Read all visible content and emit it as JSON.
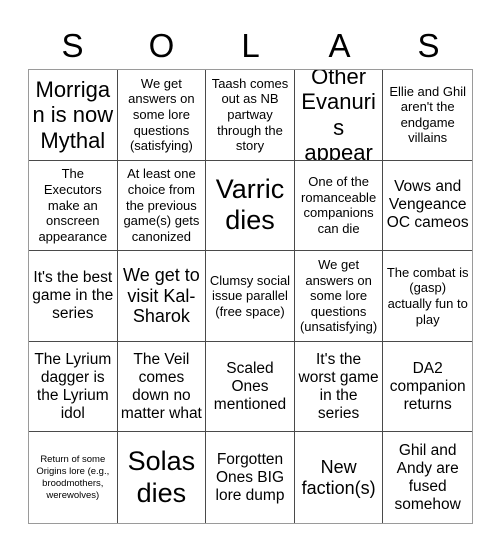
{
  "card": {
    "header_letters": [
      "S",
      "O",
      "L",
      "A",
      "S"
    ],
    "title": "SOLAS",
    "grid_size": "5x5",
    "text_color": "#000000",
    "background_color": "#ffffff",
    "grid_line_color": "#4a4a4a",
    "border_color": "#9a9a9a",
    "cells": [
      {
        "text": "Morrigan is now Mythal",
        "size": "xl",
        "marked": false
      },
      {
        "text": "We get answers on some lore questions (satisfying)",
        "size": "sm",
        "marked": false
      },
      {
        "text": "Taash comes out as NB partway through the story",
        "size": "sm",
        "marked": false
      },
      {
        "text": "Other Evanuris appear",
        "size": "xl",
        "marked": false
      },
      {
        "text": "Ellie and Ghil aren't the endgame villains",
        "size": "sm",
        "marked": false
      },
      {
        "text": "The Executors make an onscreen appearance",
        "size": "sm",
        "marked": false
      },
      {
        "text": "At least one choice from the previous game(s) gets canonized",
        "size": "sm",
        "marked": false
      },
      {
        "text": "Varric dies",
        "size": "xxl",
        "marked": false
      },
      {
        "text": "One of the romanceable companions can die",
        "size": "sm",
        "marked": false
      },
      {
        "text": "Vows and Vengeance OC cameos",
        "size": "md",
        "marked": false
      },
      {
        "text": "It's the best game in the series",
        "size": "md",
        "marked": false
      },
      {
        "text": "We get to visit Kal-Sharok",
        "size": "lg",
        "marked": false
      },
      {
        "text": "Clumsy social issue parallel (free space)",
        "size": "sm",
        "marked": false
      },
      {
        "text": "We get answers on some lore questions (unsatisfying)",
        "size": "sm",
        "marked": false
      },
      {
        "text": "The combat is (gasp) actually fun to play",
        "size": "sm",
        "marked": false
      },
      {
        "text": "The Lyrium dagger is the Lyrium idol",
        "size": "md",
        "marked": false
      },
      {
        "text": "The Veil comes down no matter what",
        "size": "md",
        "marked": false
      },
      {
        "text": "Scaled Ones mentioned",
        "size": "md",
        "marked": false
      },
      {
        "text": "It's the worst game in the series",
        "size": "md",
        "marked": false
      },
      {
        "text": "DA2 companion returns",
        "size": "md",
        "marked": false
      },
      {
        "text": "Return of some Origins lore (e.g., broodmothers, werewolves)",
        "size": "xxs",
        "marked": false
      },
      {
        "text": "Solas dies",
        "size": "xxl",
        "marked": false
      },
      {
        "text": "Forgotten Ones BIG lore dump",
        "size": "md",
        "marked": false
      },
      {
        "text": "New faction(s)",
        "size": "lg",
        "marked": false
      },
      {
        "text": "Ghil and Andy are fused somehow",
        "size": "md",
        "marked": false
      }
    ]
  }
}
